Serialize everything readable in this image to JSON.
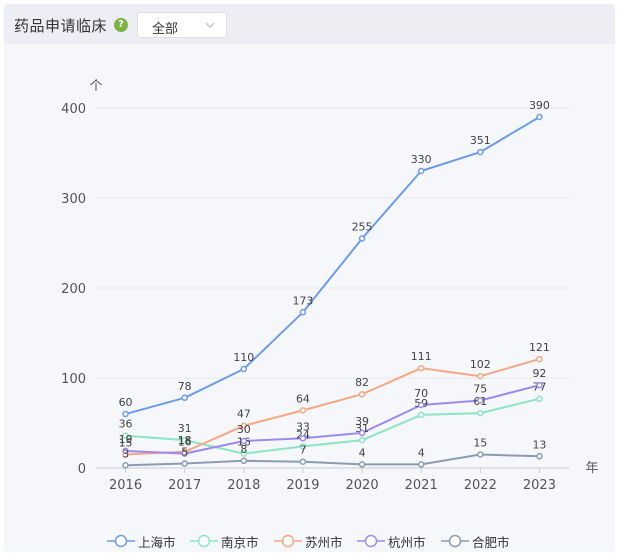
{
  "header": {
    "title": "药品申请临床",
    "help_icon": "question-icon",
    "help_glyph": "?",
    "select_value": "全部"
  },
  "chart_data": {
    "type": "line",
    "x": [
      "2016",
      "2017",
      "2018",
      "2019",
      "2020",
      "2021",
      "2022",
      "2023"
    ],
    "ylim": [
      0,
      400
    ],
    "yticks": [
      0,
      100,
      200,
      300,
      400
    ],
    "y_unit": "个",
    "x_unit": "年",
    "grid": true,
    "legend_position": "bottom",
    "series": [
      {
        "name": "上海市",
        "color": "#6b9cec",
        "values": [
          60,
          78,
          110,
          173,
          255,
          330,
          351,
          390
        ]
      },
      {
        "name": "南京市",
        "color": "#8be5c4",
        "values": [
          36,
          31,
          16,
          24,
          31,
          59,
          61,
          77
        ]
      },
      {
        "name": "苏州市",
        "color": "#f4a785",
        "values": [
          15,
          18,
          47,
          64,
          82,
          111,
          102,
          121
        ]
      },
      {
        "name": "杭州市",
        "color": "#9a8af0",
        "values": [
          19,
          16,
          30,
          33,
          39,
          70,
          75,
          92
        ]
      },
      {
        "name": "合肥市",
        "color": "#8c9bb3",
        "values": [
          3,
          5,
          8,
          7,
          4,
          4,
          15,
          13
        ]
      }
    ]
  }
}
